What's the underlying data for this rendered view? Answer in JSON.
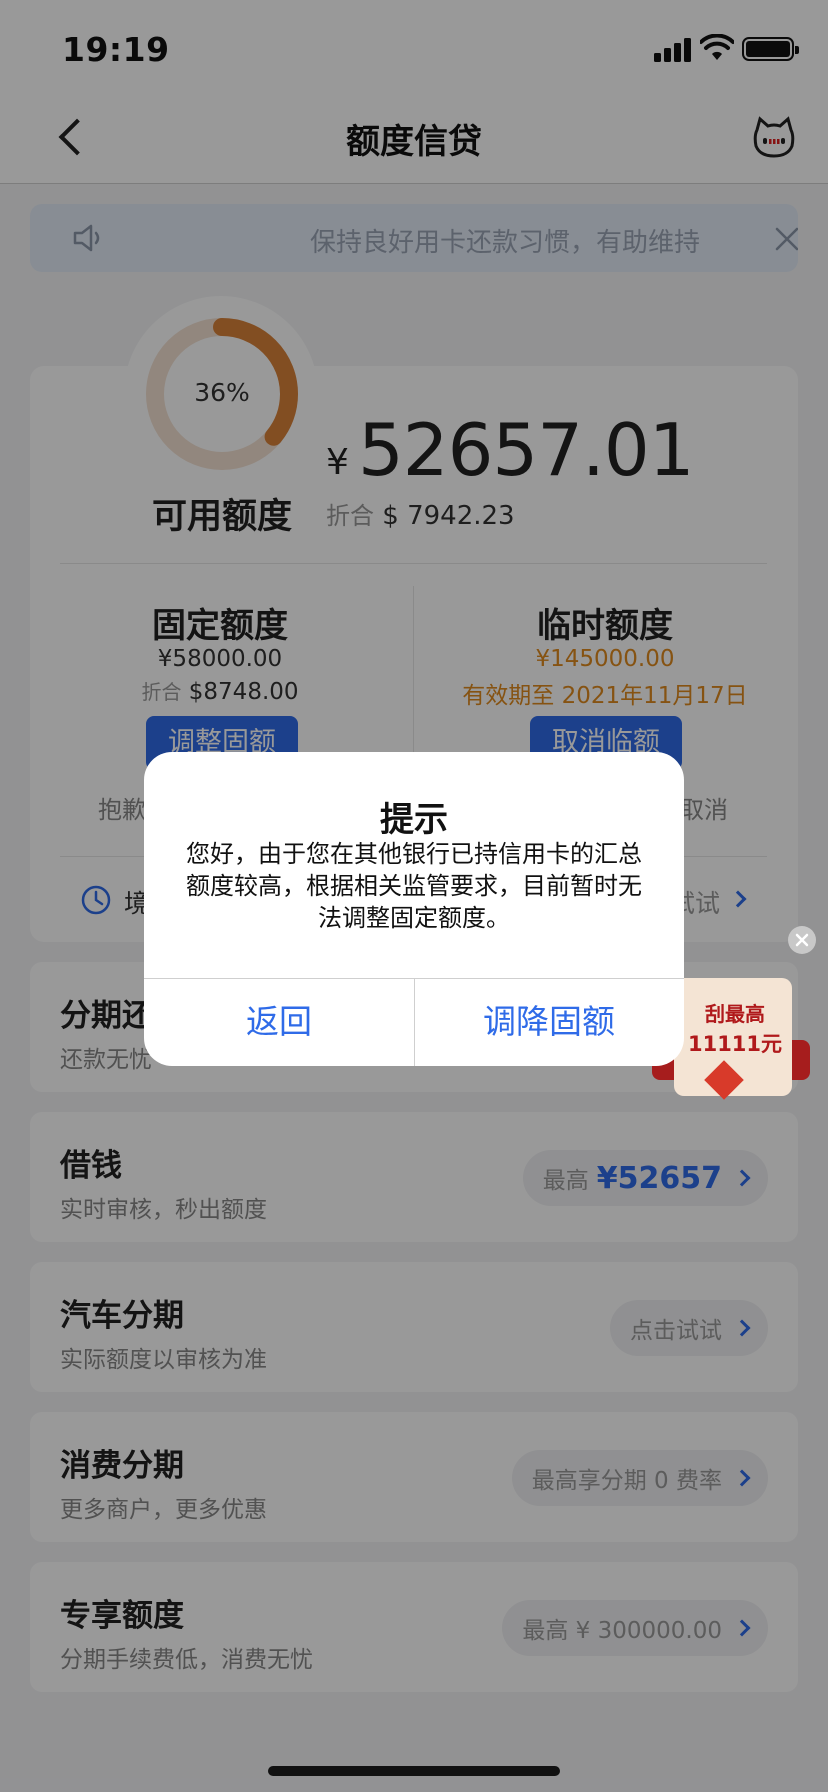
{
  "status_bar": {
    "time": "19:19"
  },
  "nav": {
    "title": "额度信贷"
  },
  "notice": {
    "text": "保持良好用卡还款习惯，有助维持"
  },
  "credit": {
    "percent_text": "36%",
    "percent_value": 36,
    "available_label": "可用额度",
    "currency_symbol": "¥",
    "available_amount": "52657.01",
    "usd_prefix": "折合",
    "usd_amount": "$ 7942.23",
    "fixed": {
      "title": "固定额度",
      "amount": "¥58000.00",
      "usd_prefix": "折合",
      "usd_amount": "$8748.00",
      "button": "调整固额",
      "sub": "抱歉"
    },
    "temp": {
      "title": "临时额度",
      "amount": "¥145000.00",
      "validity": "有效期至 2021年11月17日",
      "button": "取消临额",
      "sub": "取消"
    },
    "footer_left": "境",
    "footer_right": "试试"
  },
  "rows": [
    {
      "title": "分期还",
      "sub": "还款无忧"
    },
    {
      "title": "借钱",
      "sub": "实时审核，秒出额度",
      "pill_text": "最高",
      "pill_amount": "¥52657"
    },
    {
      "title": "汽车分期",
      "sub": "实际额度以审核为准",
      "pill_text": "点击试试"
    },
    {
      "title": "消费分期",
      "sub": "更多商户，更多优惠",
      "pill_text": "最高享分期 0 费率"
    },
    {
      "title": "专享额度",
      "sub": "分期手续费低，消费无忧",
      "pill_text": "最高 ¥ 300000.00"
    }
  ],
  "promo": {
    "line1": "刮最高",
    "line2": "11111元"
  },
  "dialog": {
    "title": "提示",
    "message": "您好，由于您在其他银行已持信用卡的汇总额度较高，根据相关监管要求，目前暂时无法调整固定额度。",
    "cancel": "返回",
    "confirm": "调降固额"
  },
  "colors": {
    "accent_blue": "#2f6be8",
    "orange": "#e08a1e",
    "ring": "#d9823a"
  },
  "icons": {
    "back": "chevron-left-icon",
    "mascot": "cat-mascot-icon",
    "speaker": "speaker-icon",
    "close": "close-icon"
  }
}
